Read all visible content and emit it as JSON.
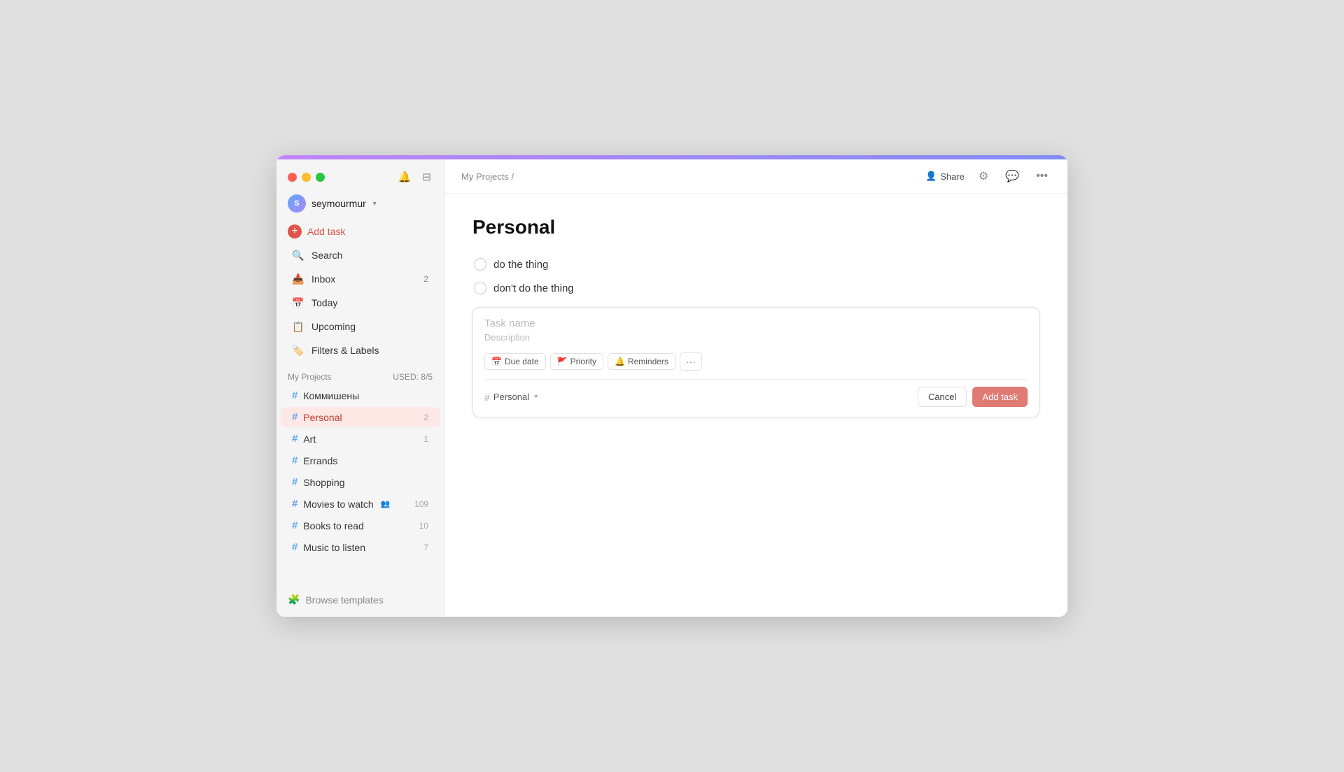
{
  "window": {
    "title": "Personal"
  },
  "titlebar": {
    "traffic": [
      "red",
      "yellow",
      "green"
    ]
  },
  "header": {
    "breadcrumb": "My Projects /",
    "share_label": "Share"
  },
  "user": {
    "name": "seymourmur",
    "avatar_initials": "S"
  },
  "sidebar": {
    "add_task_label": "Add task",
    "nav_items": [
      {
        "id": "search",
        "label": "Search",
        "icon": "🔍",
        "badge": ""
      },
      {
        "id": "inbox",
        "label": "Inbox",
        "icon": "📥",
        "badge": "2"
      },
      {
        "id": "today",
        "label": "Today",
        "icon": "📅",
        "badge": ""
      },
      {
        "id": "upcoming",
        "label": "Upcoming",
        "icon": "📋",
        "badge": ""
      },
      {
        "id": "filters",
        "label": "Filters & Labels",
        "icon": "🏷️",
        "badge": ""
      }
    ],
    "projects_header": "My Projects",
    "projects_used": "USED: 8/5",
    "projects": [
      {
        "id": "kommunishen",
        "label": "Коммишены",
        "badge": "",
        "active": false
      },
      {
        "id": "personal",
        "label": "Personal",
        "badge": "2",
        "active": true
      },
      {
        "id": "art",
        "label": "Art",
        "badge": "1",
        "active": false
      },
      {
        "id": "errands",
        "label": "Errands",
        "badge": "",
        "active": false
      },
      {
        "id": "shopping",
        "label": "Shopping",
        "badge": "",
        "active": false
      },
      {
        "id": "movies",
        "label": "Movies to watch",
        "badge": "109",
        "active": false,
        "people": true
      },
      {
        "id": "books",
        "label": "Books to read",
        "badge": "10",
        "active": false
      },
      {
        "id": "music",
        "label": "Music to listen",
        "badge": "7",
        "active": false
      }
    ],
    "browse_templates": "Browse templates"
  },
  "main": {
    "tasks": [
      {
        "id": "task1",
        "label": "do the thing"
      },
      {
        "id": "task2",
        "label": "don't do the thing"
      }
    ],
    "form": {
      "name_placeholder": "Task name",
      "desc_placeholder": "Description",
      "due_date_label": "Due date",
      "priority_label": "Priority",
      "reminders_label": "Reminders",
      "project_label": "Personal",
      "cancel_label": "Cancel",
      "add_task_label": "Add task"
    }
  }
}
